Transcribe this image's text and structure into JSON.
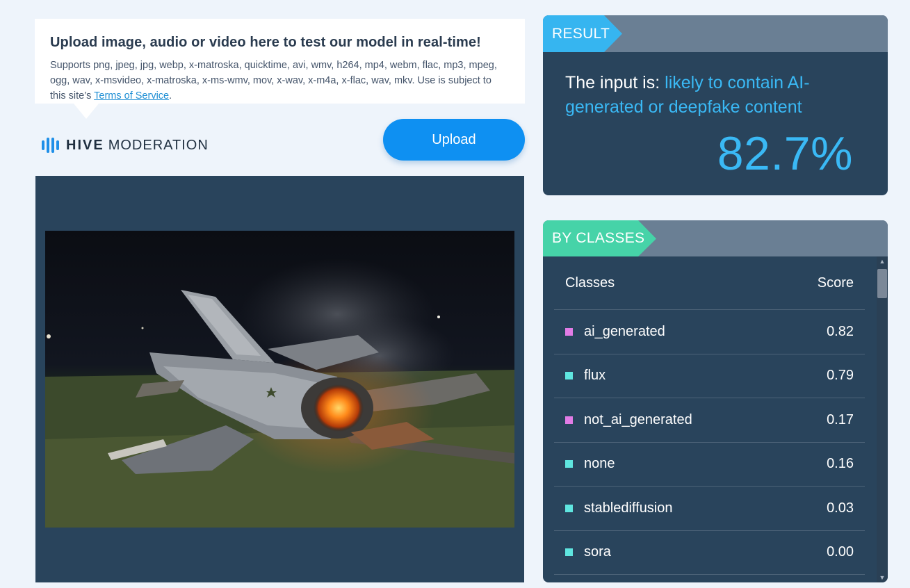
{
  "upload_info": {
    "title": "Upload image, audio or video here to test our model in real-time!",
    "supports_text": "Supports png, jpeg, jpg, webp, x-matroska, quicktime, avi, wmv, h264, mp4, webm, flac, mp3, mpeg, ogg, wav, x-msvideo, x-matroska, x-ms-wmv, mov, x-wav, x-m4a, x-flac, wav, mkv. Use is subject to this site’s ",
    "terms_link": "Terms of Service",
    "terms_suffix": "."
  },
  "logo": {
    "icon": "hive-bars-icon",
    "word_bold": "HIVE",
    "word_regular": "MODERATION"
  },
  "upload_button": {
    "label": "Upload"
  },
  "result": {
    "tab_label": "RESULT",
    "prefix": "The input is: ",
    "verdict": "likely to contain AI-generated or deepfake content",
    "percentage": "82.7%"
  },
  "classes": {
    "tab_label": "BY CLASSES",
    "header_class": "Classes",
    "header_score": "Score",
    "rows": [
      {
        "name": "ai_generated",
        "score": "0.82",
        "color": "#e27ce6"
      },
      {
        "name": "flux",
        "score": "0.79",
        "color": "#5fe6e0"
      },
      {
        "name": "not_ai_generated",
        "score": "0.17",
        "color": "#e27ce6"
      },
      {
        "name": "none",
        "score": "0.16",
        "color": "#5fe6e0"
      },
      {
        "name": "stablediffusion",
        "score": "0.03",
        "color": "#5fe6e0"
      },
      {
        "name": "sora",
        "score": "0.00",
        "color": "#5fe6e0"
      }
    ]
  },
  "colors": {
    "page_bg": "#eef4fb",
    "panel_bg": "#29445c",
    "accent_blue": "#3ab9f5",
    "accent_green": "#46d3a8",
    "button_blue": "#0e90f2"
  }
}
